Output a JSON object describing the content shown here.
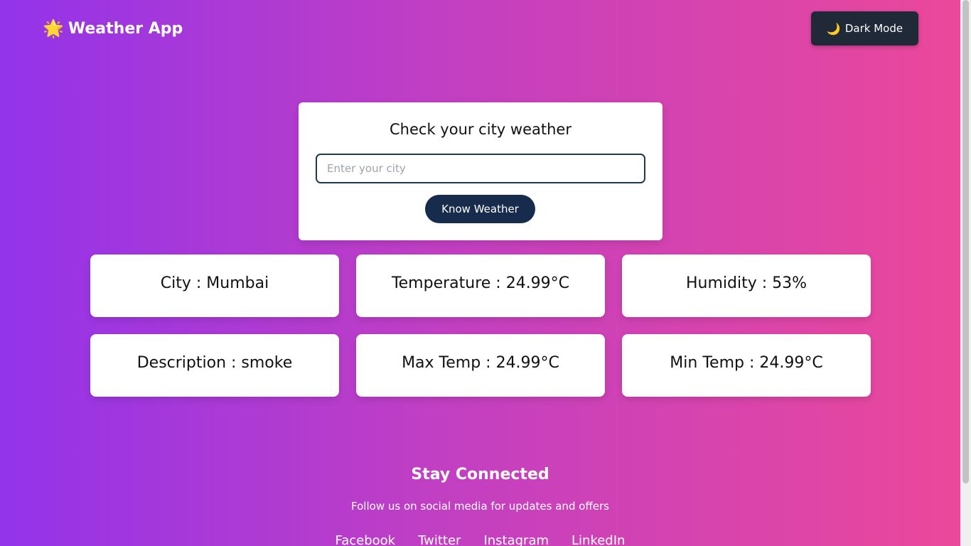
{
  "header": {
    "brand_icon": "🌟",
    "brand_title": "Weather App",
    "dark_mode_icon": "🌙",
    "dark_mode_label": "Dark Mode"
  },
  "search": {
    "title": "Check your city weather",
    "placeholder": "Enter your city",
    "value": "",
    "button_label": "Know Weather"
  },
  "weather": {
    "city": "City : Mumbai",
    "temperature": "Temperature : 24.99°C",
    "humidity": "Humidity : 53%",
    "description": "Description : smoke",
    "max_temp": "Max Temp : 24.99°C",
    "min_temp": "Min Temp : 24.99°C"
  },
  "footer": {
    "title": "Stay Connected",
    "subtitle": "Follow us on social media for updates and offers",
    "links": [
      "Facebook",
      "Twitter",
      "Instagram",
      "LinkedIn"
    ]
  },
  "colors": {
    "gradient_start": "#9333ea",
    "gradient_end": "#ec4899",
    "dark_button": "#1f2937",
    "primary_button": "#172b4d"
  }
}
